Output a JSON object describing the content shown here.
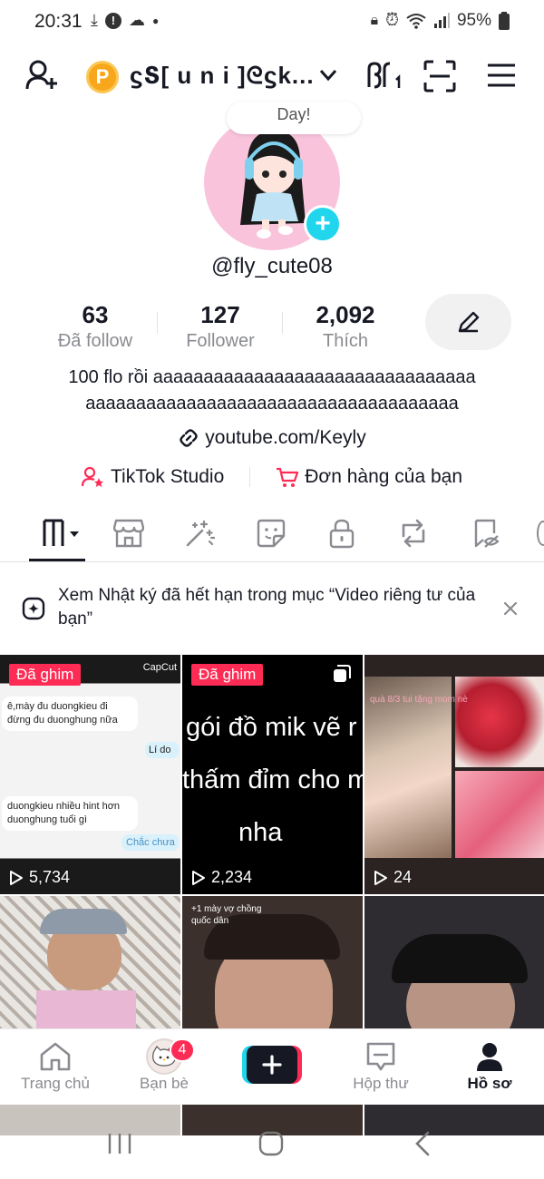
{
  "status_bar": {
    "time": "20:31",
    "battery": "95%"
  },
  "header": {
    "account_badge_letter": "P",
    "account_name": "ϛՏ[ u n i ]ᘓϛk..."
  },
  "profile": {
    "bubble_text": "Day!",
    "username": "@fly_cute08",
    "stats": [
      {
        "value": "63",
        "label": "Đã follow"
      },
      {
        "value": "127",
        "label": "Follower"
      },
      {
        "value": "2,092",
        "label": "Thích"
      }
    ],
    "bio_line1": "100 flo rồi aaaaaaaaaaaaaaaaaaaaaaaaaaaaaaaa",
    "bio_line2": "aaaaaaaaaaaaaaaaaaaaaaaaaaaaaaaaaaaaa",
    "link": "youtube.com/Keyly",
    "studio_label": "TikTok Studio",
    "orders_label": "Đơn hàng của bạn"
  },
  "notice": {
    "text": "Xem Nhật ký đã hết hạn trong mục “Video riêng tư của bạn”"
  },
  "videos": [
    {
      "pinned": "Đã ghim",
      "views": "5,734",
      "overlay": "CapCut",
      "chat1": "ê,mày đu duongkieu đi đừng đu duonghung nữa",
      "chat2": "Lí do",
      "chat3": "duongkieu nhiều hint hơn duonghung tuổi gì",
      "chat4": "Chắc chưa"
    },
    {
      "pinned": "Đã ghim",
      "views": "2,234",
      "line1": "gói đồ mik vẽ r",
      "line2": "thấm đỉm cho m",
      "line3": "nha"
    },
    {
      "views": "24",
      "caption": "quà 8/3 tui tặng mom nè"
    },
    {},
    {
      "caption": "+1 mày vợ chồng quốc dân"
    },
    {}
  ],
  "bottom_nav": {
    "home": "Trang chủ",
    "friends": "Bạn bè",
    "friends_badge": "4",
    "inbox": "Hộp thư",
    "profile": "Hồ sơ"
  },
  "colors": {
    "accent": "#fe2c55",
    "cyan": "#20d5ec",
    "text": "#161823",
    "muted": "#8a8b91"
  }
}
